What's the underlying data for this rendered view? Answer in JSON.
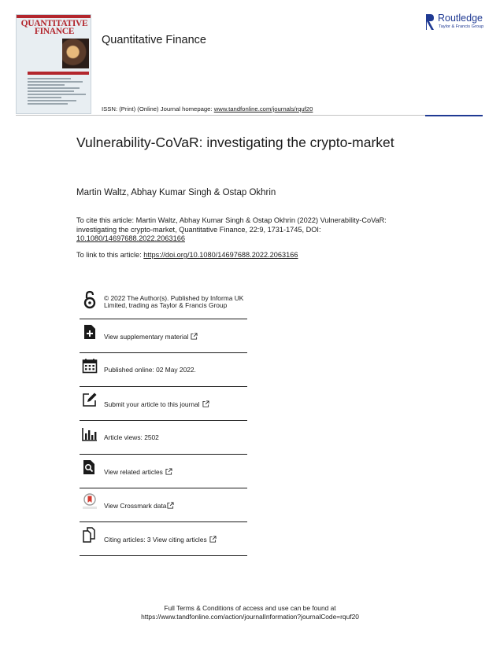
{
  "header": {
    "cover_title": "QUANTITATIVE\nFINANCE",
    "journal_name": "Quantitative Finance",
    "publisher_name": "Routledge",
    "publisher_sub": "Taylor & Francis Group",
    "issn_prefix": "ISSN: (Print) (Online) Journal homepage: ",
    "homepage_url": "www.tandfonline.com/journals/rquf20"
  },
  "article": {
    "title": "Vulnerability-CoVaR: investigating the crypto-market",
    "authors": "Martin Waltz, Abhay Kumar Singh & Ostap Okhrin",
    "cite_text": "To cite this article: Martin Waltz, Abhay Kumar Singh & Ostap Okhrin (2022) Vulnerability-CoVaR: investigating the crypto-market, Quantitative Finance, 22:9, 1731-1745, DOI:",
    "cite_doi": "10.1080/14697688.2022.2063166",
    "link_prefix": "To link to this article: ",
    "link_url": "https://doi.org/10.1080/14697688.2022.2063166"
  },
  "info": {
    "license": "© 2022 The Author(s). Published by Informa UK Limited, trading as Taylor & Francis Group",
    "supplementary": "View supplementary material",
    "published": "Published online: 02 May 2022.",
    "submit": "Submit your article to this journal",
    "views": "Article views: 2502",
    "related": "View related articles",
    "crossmark": "View Crossmark data",
    "citing": "Citing articles: 3 View citing articles"
  },
  "footer": {
    "line1": "Full Terms & Conditions of access and use can be found at",
    "line2": "https://www.tandfonline.com/action/journalInformation?journalCode=rquf20"
  },
  "colors": {
    "publisher_blue": "#1f3a93",
    "cover_red": "#b3262d",
    "crossmark_red": "#d43a2f",
    "text": "#1a1a1a"
  }
}
